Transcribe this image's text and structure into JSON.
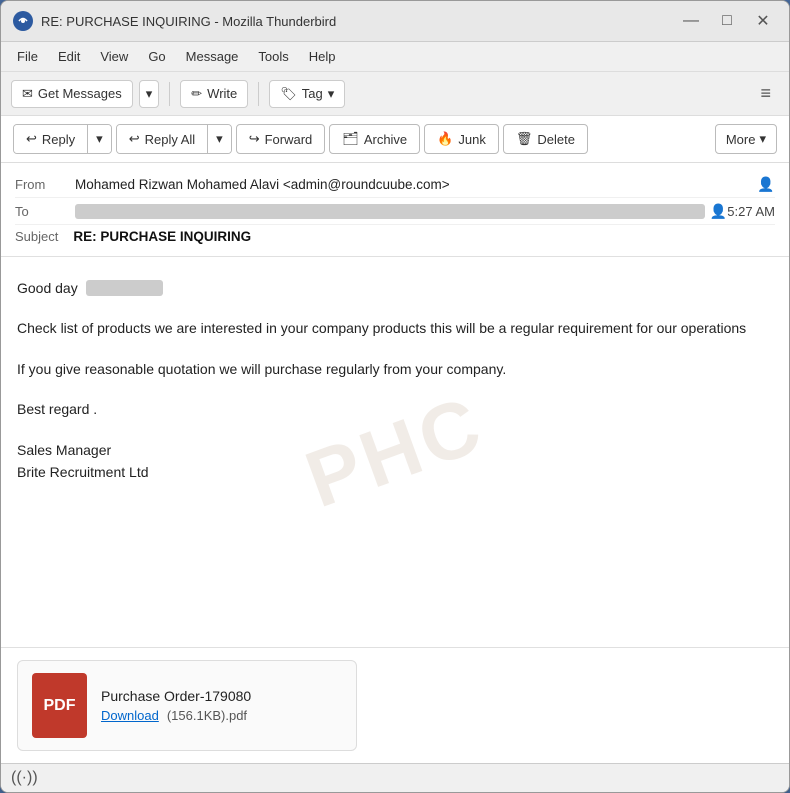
{
  "window": {
    "title": "RE: PURCHASE INQUIRING - Mozilla Thunderbird",
    "app_icon_label": "TB",
    "controls": {
      "minimize": "—",
      "maximize": "□",
      "close": "✕"
    }
  },
  "menu": {
    "items": [
      "File",
      "Edit",
      "View",
      "Go",
      "Message",
      "Tools",
      "Help"
    ]
  },
  "toolbar": {
    "get_messages": "Get Messages",
    "write": "Write",
    "tag": "Tag",
    "hamburger": "≡"
  },
  "action_toolbar": {
    "reply": "Reply",
    "reply_all": "Reply All",
    "forward": "Forward",
    "archive": "Archive",
    "junk": "Junk",
    "delete": "Delete",
    "more": "More"
  },
  "email_header": {
    "from_label": "From",
    "from_value": "Mohamed Rizwan Mohamed Alavi <admin@roundcuube.com>",
    "to_label": "To",
    "to_value": "████████████",
    "time": "5:27 AM",
    "subject_label": "Subject",
    "subject_value": "RE: PURCHASE INQUIRING"
  },
  "email_body": {
    "greeting": "Good day",
    "greeting_name": "███████████████",
    "paragraph1": "Check list of products we are interested in your company products this will be a regular requirement for our operations",
    "paragraph2": "If you give reasonable quotation we will purchase regularly from your company.",
    "closing": "Best regard .",
    "signature_line1": "Sales Manager",
    "signature_line2": "Brite Recruitment Ltd"
  },
  "attachment": {
    "pdf_label": "PDF",
    "filename": "Purchase Order-179080",
    "download_label": "Download",
    "size": "(156.1KB).pdf"
  },
  "status_bar": {
    "wifi_symbol": "((·))"
  },
  "icons": {
    "reply_icon": "↩",
    "reply_all_icon": "↩",
    "forward_icon": "↪",
    "archive_icon": "🗃",
    "junk_icon": "🔥",
    "delete_icon": "🗑",
    "chevron_down": "▾",
    "get_messages_icon": "✉",
    "write_icon": "✏",
    "tag_icon": "🏷",
    "privacy_icon": "👤"
  }
}
